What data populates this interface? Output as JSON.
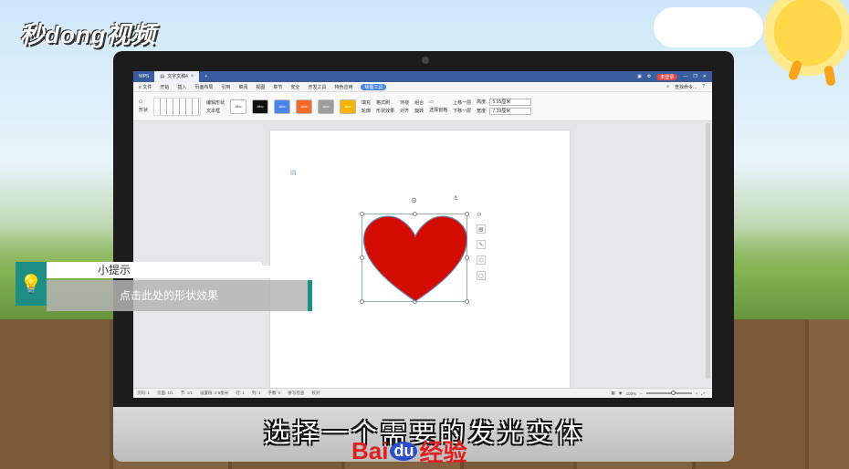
{
  "brand": {
    "logo_text": "秒dong视频"
  },
  "window": {
    "tabs": [
      {
        "label": "WPS"
      },
      {
        "label": "文字文稿4"
      }
    ],
    "new_tab": "+",
    "signin_label": "未登录"
  },
  "menubar": {
    "file": "≡ 文件",
    "items": [
      "开始",
      "插入",
      "页面布局",
      "引用",
      "审阅",
      "视图",
      "章节",
      "安全",
      "开发工具",
      "特色应用"
    ],
    "active": "绘图工具",
    "search": "查找命令...",
    "help": "?"
  },
  "ribbon": {
    "shape_label": "形状",
    "edit_shape": "编辑形状",
    "text_box": "文本框",
    "styles": [
      {
        "label": "Abc",
        "bg": "#ffffff",
        "fg": "#333333"
      },
      {
        "label": "Abc",
        "bg": "#111111",
        "fg": "#ffffff"
      },
      {
        "label": "Abc",
        "bg": "#4a86e8",
        "fg": "#ffffff"
      },
      {
        "label": "Abc",
        "bg": "#f26b2a",
        "fg": "#ffffff"
      },
      {
        "label": "Abc",
        "bg": "#9e9e9e",
        "fg": "#ffffff"
      },
      {
        "label": "Abc",
        "bg": "#f5b400",
        "fg": "#ffffff"
      }
    ],
    "fill": "填充",
    "format_brush": "格式刷",
    "outline": "轮廓",
    "shape_effect": "形状效果",
    "wrap": "环绕",
    "align": "对齐",
    "group": "组合",
    "rotate": "旋转",
    "select_pane": "选择窗格",
    "up_one": "上移一层",
    "down_one": "下移一层",
    "height_label": "高度:",
    "height_value": "5.95厘米",
    "width_label": "宽度:",
    "width_value": "7.39厘米"
  },
  "statusbar": {
    "page": "页码: 1",
    "pages": "页面: 1/1",
    "section": "节: 1/1",
    "setting": "设置值: 2.5厘米",
    "row": "行: 1",
    "col": "列: 1",
    "words": "字数: 0",
    "spell": "拼写检查",
    "proof": "校对",
    "zoom": "100%",
    "zoom_fraction": 0.55
  },
  "shape": {
    "fill_color": "#d40b00",
    "outline_color": "#6b7fb0"
  },
  "tip": {
    "title": "小提示",
    "body": "点击此处的形状效果"
  },
  "subtitle": "选择一个需要的发光变体",
  "watermark": {
    "bai": "Bai",
    "du": "du",
    "jingyan": "经验"
  }
}
